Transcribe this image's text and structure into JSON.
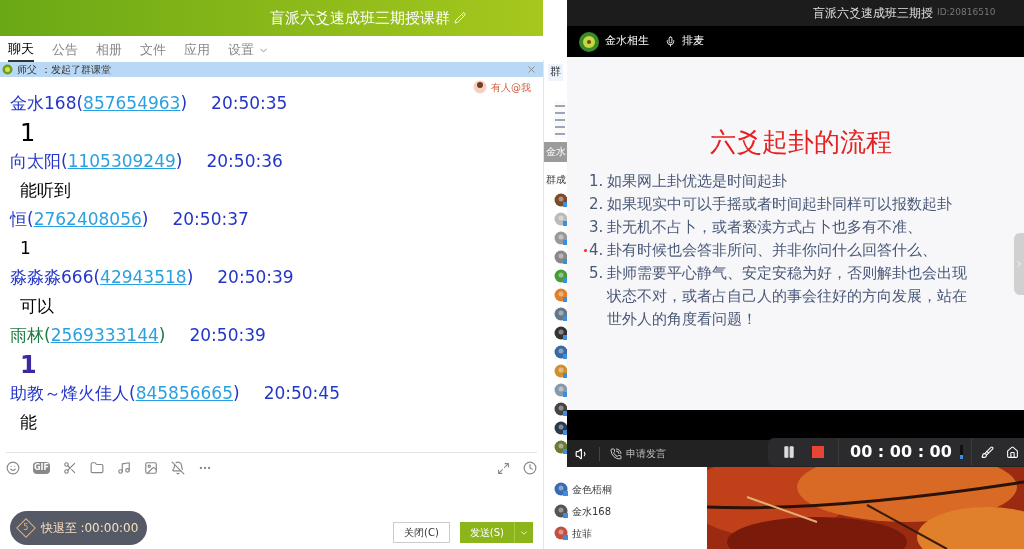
{
  "chat_window": {
    "title": "盲派六爻速成班三期授课群",
    "tabs": [
      {
        "label": "聊天",
        "selected": true
      },
      {
        "label": "公告",
        "selected": false
      },
      {
        "label": "相册",
        "selected": false
      },
      {
        "label": "文件",
        "selected": false
      },
      {
        "label": "应用",
        "selected": false
      },
      {
        "label": "设置",
        "selected": false
      }
    ],
    "notice": {
      "sender": "师父",
      "text": "：发起了群课堂"
    },
    "mention_badge": "有人@我",
    "messages": [
      {
        "sender": "金水168",
        "open": "(",
        "qq": "857654963",
        "close": ")",
        "time": "20:50:35",
        "text": "1",
        "kind": "big",
        "color": "#2436c8"
      },
      {
        "sender": "向太阳",
        "open": "(",
        "qq": "1105309249",
        "close": ")",
        "time": "20:50:36",
        "text": "能听到",
        "kind": "plain",
        "color": "#2436c8"
      },
      {
        "sender": "恒",
        "open": "(",
        "qq": "2762408056",
        "close": ")",
        "time": "20:50:37",
        "text": "1",
        "kind": "plain",
        "color": "#2436c8"
      },
      {
        "sender": "淼淼淼666",
        "open": "(",
        "qq": "42943518",
        "close": ")",
        "time": "20:50:39",
        "text": "可以",
        "kind": "plain",
        "color": "#2436c8"
      },
      {
        "sender": "雨林",
        "open": "(",
        "qq": "2569333144",
        "close": ")",
        "time": "20:50:39",
        "text": "1",
        "kind": "bold",
        "color": "#1f7a45"
      },
      {
        "sender": "助教～烽火佳人",
        "open": "(",
        "qq": "845856665",
        "close": ")",
        "time": "20:50:45",
        "text": "能",
        "kind": "plain",
        "color": "#2436c8"
      }
    ],
    "gif_label": "GIF",
    "rewind": {
      "badge": "5",
      "text": "快退至 :00:00:00"
    },
    "buttons": [
      {
        "label": "关闭(C)",
        "kind": "secondary"
      },
      {
        "label": "发送(S)",
        "kind": "primary"
      }
    ]
  },
  "member_panel": {
    "tab": "群",
    "banner": "金水",
    "heading": "群成",
    "members": [
      {
        "name": "金色梧桐"
      },
      {
        "name": "金水168"
      },
      {
        "name": "拉菲"
      }
    ]
  },
  "video_window": {
    "title": "盲派六爻速成班三期授",
    "room_id": "ID:20816510",
    "presenter": "金水相生",
    "queue": "排麦",
    "slide": {
      "title": "六爻起卦的流程",
      "items": [
        {
          "number": "1.",
          "lines": [
            "如果网上卦优选是时间起卦"
          ],
          "pointer": false
        },
        {
          "number": "2.",
          "lines": [
            "如果现实中可以手摇或者时间起卦同样可以报数起卦"
          ],
          "pointer": false
        },
        {
          "number": "3.",
          "lines": [
            "卦无机不占卜，或者亵渎方式占卜也多有不准、"
          ],
          "pointer": false
        },
        {
          "number": "4.",
          "lines": [
            "卦有时候也会答非所问、并非你问什么回答什么、"
          ],
          "pointer": true
        },
        {
          "number": "5.",
          "lines": [
            "卦师需要平心静气、安定安稳为好，否则解卦也会出现",
            "状态不对，或者占自己人的事会往好的方向发展，站在",
            "世外人的角度看问题！"
          ],
          "pointer": false
        }
      ]
    },
    "speak_button": "申请发言",
    "timer": "00 : 00 : 00"
  }
}
